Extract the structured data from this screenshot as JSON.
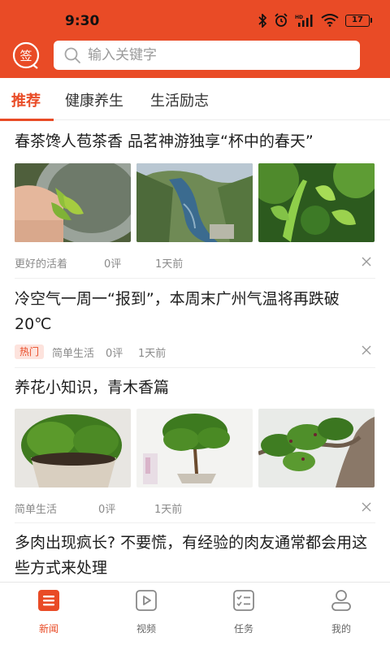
{
  "status_bar": {
    "time": "9:30",
    "battery": "17",
    "icons": [
      "bluetooth-icon",
      "alarm-icon",
      "hd-signal-icon",
      "wifi-icon",
      "battery-icon"
    ]
  },
  "header": {
    "sign_icon": "签",
    "search_placeholder": "输入关键字",
    "accent_color": "#e94b26"
  },
  "tabs": [
    {
      "label": "推荐",
      "active": true
    },
    {
      "label": "健康养生",
      "active": false
    },
    {
      "label": "生活励志",
      "active": false
    }
  ],
  "articles": [
    {
      "title": "春茶馋人苞茶香 品茗神游独享“杯中的春天”",
      "source": "更好的活着",
      "comments": "0评",
      "time": "1天前",
      "hot": "",
      "images": [
        "tea-picking-image",
        "river-valley-image",
        "tea-plants-image"
      ]
    },
    {
      "title": "冷空气一周一“报到”，本周末广州气温将再跌破20℃",
      "source": "简单生活",
      "comments": "0评",
      "time": "1天前",
      "hot": "热门",
      "images": []
    },
    {
      "title": "养花小知识，青木香篇",
      "source": "简单生活",
      "comments": "0评",
      "time": "1天前",
      "hot": "",
      "images": [
        "potted-plant-image",
        "bonsai-tree-image",
        "branch-closeup-image"
      ]
    },
    {
      "title": "多肉出现疯长? 不要慌，有经验的肉友通常都会用这些方式来处理",
      "source": "",
      "comments": "",
      "time": "",
      "hot": "",
      "images": []
    }
  ],
  "bottom_nav": [
    {
      "label": "新闻",
      "icon": "news-icon",
      "active": true
    },
    {
      "label": "视频",
      "icon": "video-icon",
      "active": false
    },
    {
      "label": "任务",
      "icon": "task-icon",
      "active": false
    },
    {
      "label": "我的",
      "icon": "profile-icon",
      "active": false
    }
  ]
}
